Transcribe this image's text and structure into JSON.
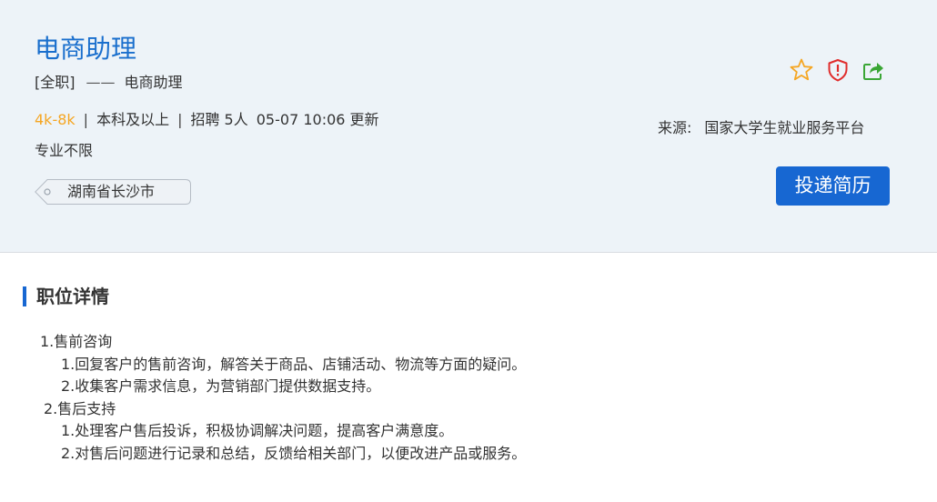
{
  "job": {
    "title": "电商助理",
    "type": "[全职]",
    "dash": "——",
    "category": "电商助理",
    "salary": "4k-8k",
    "separator": "|",
    "education": "本科及以上",
    "headcount": "招聘 5人",
    "updated": "05-07 10:06 更新",
    "major": "专业不限",
    "location": "湖南省长沙市"
  },
  "actions": {
    "icons": [
      "star-icon",
      "report-icon",
      "share-icon"
    ],
    "apply_label": "投递简历"
  },
  "source": {
    "label": "来源:",
    "value": "国家大学生就业服务平台"
  },
  "detail": {
    "section_title": "职位详情",
    "lines": [
      "1.售前咨询",
      "1.回复客户的售前咨询，解答关于商品、店铺活动、物流等方面的疑问。",
      "2.收集客户需求信息，为营销部门提供数据支持。",
      "2.售后支持",
      "1.处理客户售后投诉，积极协调解决问题，提高客户满意度。",
      "2.对售后问题进行记录和总结，反馈给相关部门，以便改进产品或服务。"
    ]
  },
  "colors": {
    "accent": "#1767d2",
    "title": "#1a6fcd",
    "salary": "#f5a623",
    "header_bg": "#edf3f8",
    "star": "#f5a623",
    "report": "#e02d2d",
    "share": "#3aa635"
  }
}
